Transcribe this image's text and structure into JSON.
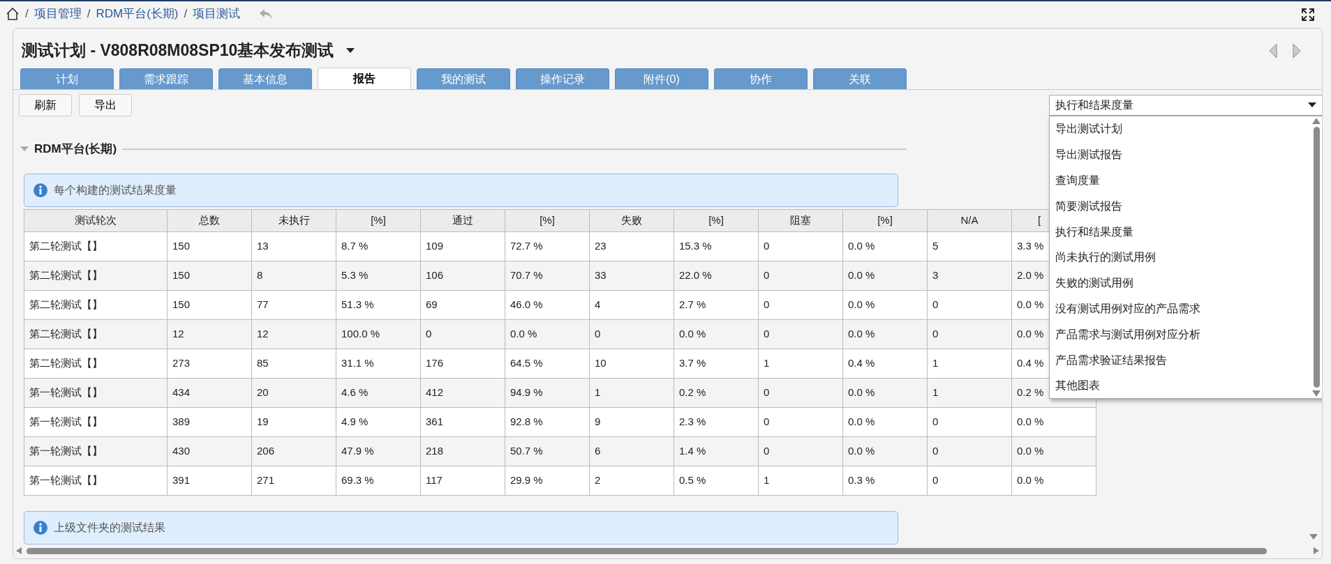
{
  "breadcrumb": [
    "项目管理",
    "RDM平台(长期)",
    "项目测试"
  ],
  "breadcrumb_separator": "/",
  "title": "测试计划 - V808R08M08SP10基本发布测试",
  "tabs": [
    {
      "label": "计划",
      "selected": false
    },
    {
      "label": "需求跟踪",
      "selected": false
    },
    {
      "label": "基本信息",
      "selected": false
    },
    {
      "label": "报告",
      "selected": true
    },
    {
      "label": "我的测试",
      "selected": false
    },
    {
      "label": "操作记录",
      "selected": false
    },
    {
      "label": "附件(0)",
      "selected": false
    },
    {
      "label": "协作",
      "selected": false
    },
    {
      "label": "关联",
      "selected": false
    }
  ],
  "toolbar": [
    "刷新",
    "导出"
  ],
  "report_select": {
    "value": "执行和结果度量",
    "expanded": true,
    "options": [
      "导出测试计划",
      "导出测试报告",
      "查询度量",
      "简要测试报告",
      "执行和结果度量",
      "尚未执行的测试用例",
      "失败的测试用例",
      "没有测试用例对应的产品需求",
      "产品需求与测试用例对应分析",
      "产品需求验证结果报告",
      "其他图表"
    ]
  },
  "section": {
    "title": "RDM平台(长期)",
    "expanded": true
  },
  "info_boxes": [
    "每个构建的测试结果度量",
    "上级文件夹的测试结果"
  ],
  "table": {
    "columns": [
      "测试轮次",
      "总数",
      "未执行",
      "[%]",
      "通过",
      "[%]",
      "失败",
      "[%]",
      "阻塞",
      "[%]",
      "N/A",
      "["
    ],
    "rows": [
      [
        "第二轮测试【】",
        "150",
        "13",
        "8.7 %",
        "109",
        "72.7 %",
        "23",
        "15.3 %",
        "0",
        "0.0 %",
        "5",
        "3.3 %"
      ],
      [
        "第二轮测试【】",
        "150",
        "8",
        "5.3 %",
        "106",
        "70.7 %",
        "33",
        "22.0 %",
        "0",
        "0.0 %",
        "3",
        "2.0 %"
      ],
      [
        "第二轮测试【】",
        "150",
        "77",
        "51.3 %",
        "69",
        "46.0 %",
        "4",
        "2.7 %",
        "0",
        "0.0 %",
        "0",
        "0.0 %"
      ],
      [
        "第二轮测试【】",
        "12",
        "12",
        "100.0 %",
        "0",
        "0.0 %",
        "0",
        "0.0 %",
        "0",
        "0.0 %",
        "0",
        "0.0 %"
      ],
      [
        "第二轮测试【】",
        "273",
        "85",
        "31.1 %",
        "176",
        "64.5 %",
        "10",
        "3.7 %",
        "1",
        "0.4 %",
        "1",
        "0.4 %"
      ],
      [
        "第一轮测试【】",
        "434",
        "20",
        "4.6 %",
        "412",
        "94.9 %",
        "1",
        "0.2 %",
        "0",
        "0.0 %",
        "1",
        "0.2 %"
      ],
      [
        "第一轮测试【】",
        "389",
        "19",
        "4.9 %",
        "361",
        "92.8 %",
        "9",
        "2.3 %",
        "0",
        "0.0 %",
        "0",
        "0.0 %"
      ],
      [
        "第一轮测试【】",
        "430",
        "206",
        "47.9 %",
        "218",
        "50.7 %",
        "6",
        "1.4 %",
        "0",
        "0.0 %",
        "0",
        "0.0 %"
      ],
      [
        "第一轮测试【】",
        "391",
        "271",
        "69.3 %",
        "117",
        "29.9 %",
        "2",
        "0.5 %",
        "1",
        "0.3 %",
        "0",
        "0.0 %"
      ]
    ]
  }
}
